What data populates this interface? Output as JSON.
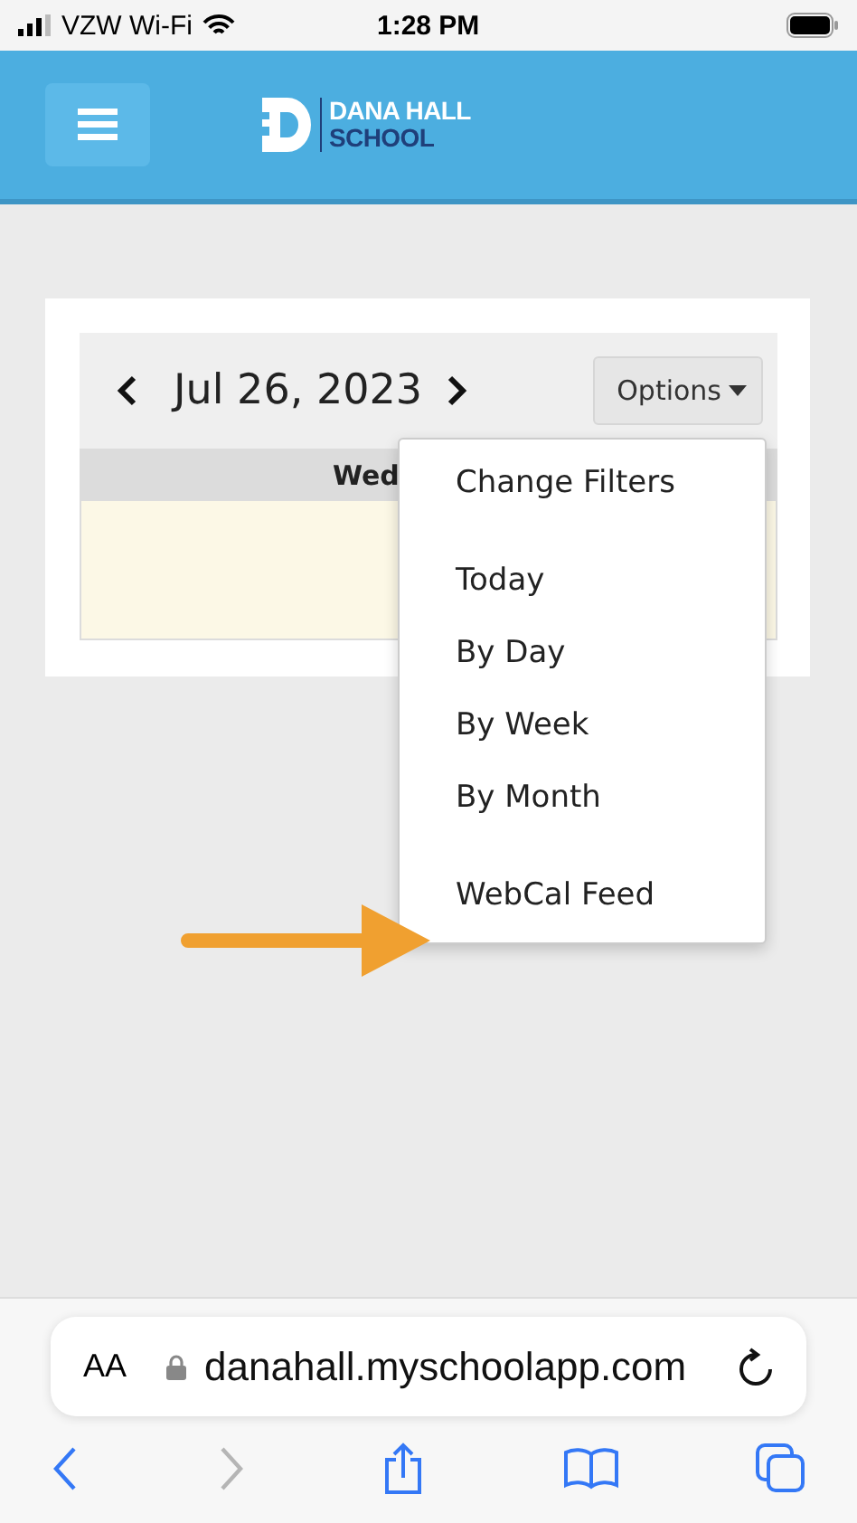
{
  "status_bar": {
    "carrier": "VZW Wi-Fi",
    "time": "1:28 PM"
  },
  "header": {
    "logo_line_1": "DANA HALL",
    "logo_line_2": "SCHOOL"
  },
  "calendar": {
    "date": "Jul 26, 2023",
    "options_label": "Options",
    "column_heading": "Wed"
  },
  "options_menu": {
    "groups": [
      [
        "Change Filters"
      ],
      [
        "Today",
        "By Day",
        "By Week",
        "By Month"
      ],
      [
        "WebCal Feed"
      ]
    ]
  },
  "browser": {
    "text_size_label": "AA",
    "url": "danahall.myschoolapp.com",
    "back": {
      "disabled": false
    },
    "forward": {
      "disabled": true
    }
  }
}
